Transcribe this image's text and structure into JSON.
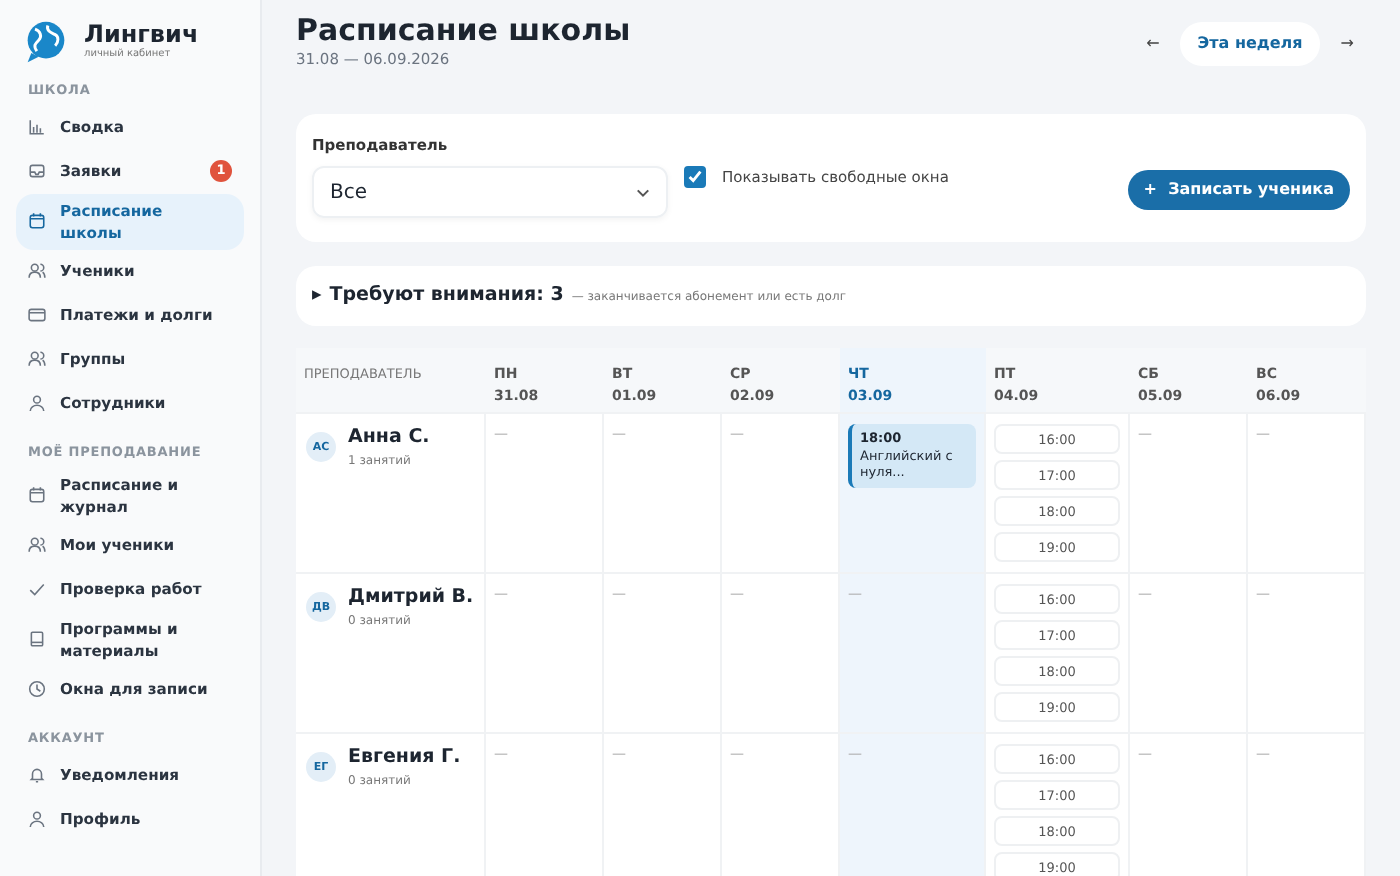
{
  "brand": {
    "name": "Лингвич",
    "subtitle": "личный кабинет"
  },
  "sidebar": {
    "sections": [
      {
        "title": "ШКОЛА",
        "items": [
          {
            "label": "Сводка",
            "selected": false
          },
          {
            "label": "Заявки",
            "selected": false,
            "badge": "1"
          },
          {
            "label": "Расписание школы",
            "selected": true
          },
          {
            "label": "Ученики",
            "selected": false
          },
          {
            "label": "Платежи и долги",
            "selected": false
          },
          {
            "label": "Группы",
            "selected": false
          },
          {
            "label": "Сотрудники",
            "selected": false
          }
        ]
      },
      {
        "title": "МОЁ ПРЕПОДАВАНИЕ",
        "items": [
          {
            "label": "Расписание и журнал",
            "selected": false
          },
          {
            "label": "Мои ученики",
            "selected": false
          },
          {
            "label": "Проверка работ",
            "selected": false
          },
          {
            "label": "Программы и материалы",
            "selected": false
          },
          {
            "label": "Окна для записи",
            "selected": false
          }
        ]
      },
      {
        "title": "АККАУНТ",
        "items": [
          {
            "label": "Уведомления",
            "selected": false
          },
          {
            "label": "Профиль",
            "selected": false
          }
        ]
      }
    ]
  },
  "header": {
    "title": "Расписание школы",
    "range": "31.08 — 06.09.2026",
    "prev": "←",
    "current": "Эта неделя",
    "next": "→"
  },
  "filters": {
    "teacher_label": "Преподаватель",
    "teacher_value": "Все",
    "show_free": {
      "label": "Показывать свободные окна",
      "checked": true
    },
    "add_button": "Записать ученика",
    "add_icon": "+"
  },
  "attention": {
    "marker": "▸",
    "title": "Требуют внимания: 3",
    "note": "— заканчивается абонемент или есть долг",
    "expanded": false
  },
  "schedule": {
    "teacher_column": "ПРЕПОДАВАТЕЛЬ",
    "days": [
      {
        "name": "ПН",
        "date": "31.08",
        "today": false
      },
      {
        "name": "ВТ",
        "date": "01.09",
        "today": false
      },
      {
        "name": "СР",
        "date": "02.09",
        "today": false
      },
      {
        "name": "ЧТ",
        "date": "03.09",
        "today": true
      },
      {
        "name": "ПТ",
        "date": "04.09",
        "today": false
      },
      {
        "name": "СБ",
        "date": "05.09",
        "today": false
      },
      {
        "name": "ВС",
        "date": "06.09",
        "today": false
      }
    ],
    "teachers": [
      {
        "initials": "АС",
        "name": "Анна С.",
        "lessons": "1 занятий",
        "cells": [
          {
            "kind": "empty",
            "text": "—"
          },
          {
            "kind": "empty",
            "text": "—"
          },
          {
            "kind": "empty",
            "text": "—"
          },
          {
            "kind": "lesson",
            "time": "18:00",
            "title": "Английский с нуля..."
          },
          {
            "kind": "slots",
            "slots": [
              "16:00",
              "17:00",
              "18:00",
              "19:00"
            ]
          },
          {
            "kind": "empty",
            "text": "—"
          },
          {
            "kind": "empty",
            "text": "—"
          }
        ]
      },
      {
        "initials": "ДВ",
        "name": "Дмитрий В.",
        "lessons": "0 занятий",
        "cells": [
          {
            "kind": "empty",
            "text": "—"
          },
          {
            "kind": "empty",
            "text": "—"
          },
          {
            "kind": "empty",
            "text": "—"
          },
          {
            "kind": "empty",
            "text": "—"
          },
          {
            "kind": "slots",
            "slots": [
              "16:00",
              "17:00",
              "18:00",
              "19:00"
            ]
          },
          {
            "kind": "empty",
            "text": "—"
          },
          {
            "kind": "empty",
            "text": "—"
          }
        ]
      },
      {
        "initials": "ЕГ",
        "name": "Евгения Г.",
        "lessons": "0 занятий",
        "cells": [
          {
            "kind": "empty",
            "text": "—"
          },
          {
            "kind": "empty",
            "text": "—"
          },
          {
            "kind": "empty",
            "text": "—"
          },
          {
            "kind": "empty",
            "text": "—"
          },
          {
            "kind": "slots",
            "slots": [
              "16:00",
              "17:00",
              "18:00",
              "19:00"
            ]
          },
          {
            "kind": "empty",
            "text": "—"
          },
          {
            "kind": "empty",
            "text": "—"
          }
        ]
      }
    ]
  }
}
